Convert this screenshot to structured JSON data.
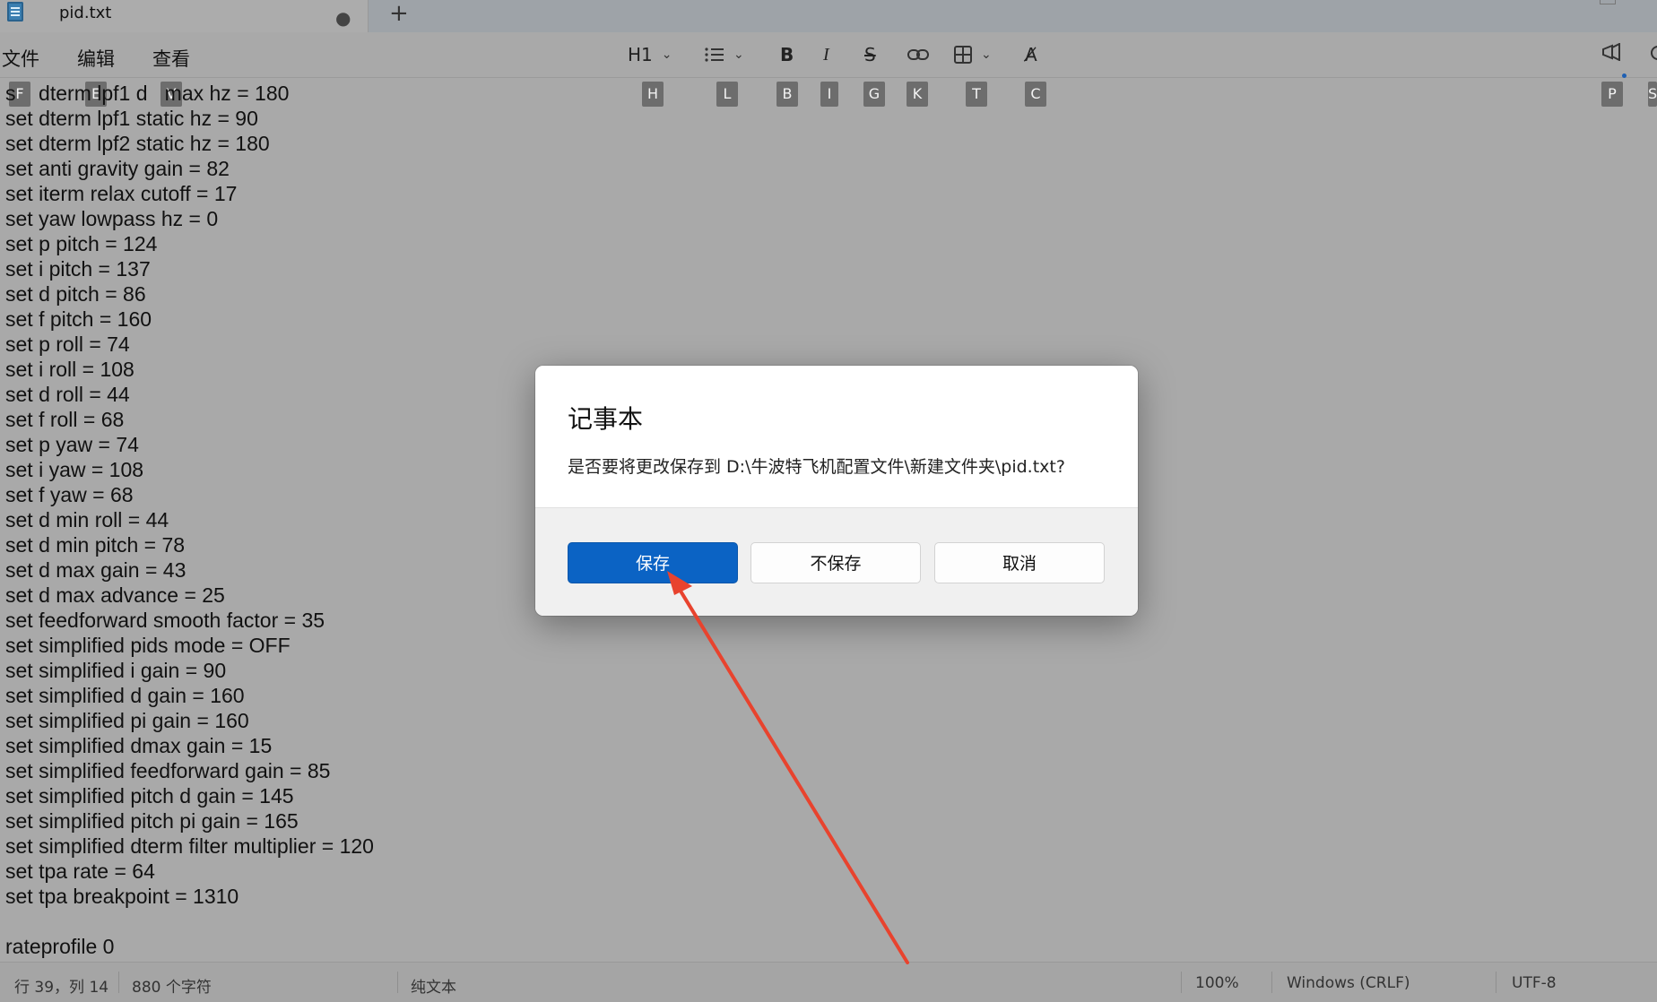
{
  "window": {
    "tab_title": "pid.txt",
    "unsaved_dot": "●",
    "new_tab": "+"
  },
  "menu": [
    "文件",
    "编辑",
    "查看"
  ],
  "toolbar": {
    "heading": "H1",
    "list_icon": "list-icon",
    "bold": "B",
    "italic": "I",
    "strike": "S",
    "link_icon": "link-icon",
    "table_icon": "table-icon",
    "clear_format": "A̸",
    "chevron": "⌄"
  },
  "keytips": {
    "menu": [
      "F",
      "E",
      "V"
    ],
    "toolbar": [
      "H",
      "L",
      "B",
      "I",
      "G",
      "K",
      "T",
      "C"
    ],
    "right": [
      "P",
      "S"
    ]
  },
  "editor": {
    "lines": [
      "s    dterm lpf1 d   max hz = 180",
      "set dterm lpf1 static hz = 90",
      "set dterm lpf2 static hz = 180",
      "set anti gravity gain = 82",
      "set iterm relax cutoff = 17",
      "set yaw lowpass hz = 0",
      "set p pitch = 124",
      "set i pitch = 137",
      "set d pitch = 86",
      "set f pitch = 160",
      "set p roll = 74",
      "set i roll = 108",
      "set d roll = 44",
      "set f roll = 68",
      "set p yaw = 74",
      "set i yaw = 108",
      "set f yaw = 68",
      "set d min roll = 44",
      "set d min pitch = 78",
      "set d max gain = 43",
      "set d max advance = 25",
      "set feedforward smooth factor = 35",
      "set simplified pids mode = OFF",
      "set simplified i gain = 90",
      "set simplified d gain = 160",
      "set simplified pi gain = 160",
      "set simplified dmax gain = 15",
      "set simplified feedforward gain = 85",
      "set simplified pitch d gain = 145",
      "set simplified pitch pi gain = 165",
      "set simplified dterm filter multiplier = 120",
      "set tpa rate = 64",
      "set tpa breakpoint = 1310",
      "",
      "rateprofile 0"
    ]
  },
  "dialog": {
    "title": "记事本",
    "message": "是否要将更改保存到 D:\\牛波特飞机配置文件\\新建文件夹\\pid.txt?",
    "save": "保存",
    "dont_save": "不保存",
    "cancel": "取消"
  },
  "status": {
    "position": "行 39，列 14",
    "chars": "880 个字符",
    "format": "纯文本",
    "zoom": "100%",
    "line_ending": "Windows (CRLF)",
    "encoding": "UTF-8"
  },
  "colors": {
    "accent": "#0b63c4",
    "annotation_arrow": "#e8432e"
  }
}
